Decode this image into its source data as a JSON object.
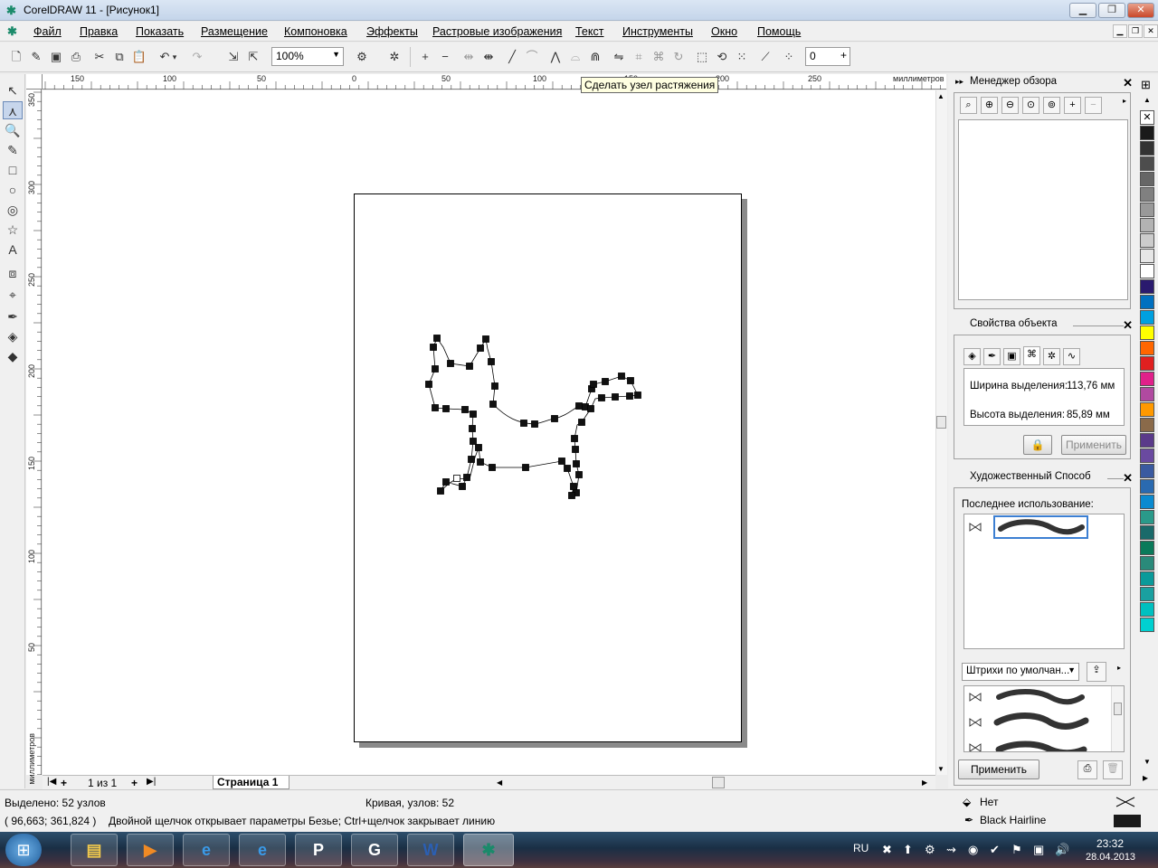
{
  "window": {
    "title": "CorelDRAW 11 - [Рисунок1]"
  },
  "menu": [
    "Файл",
    "Правка",
    "Показать",
    "Размещение",
    "Компоновка",
    "Эффекты",
    "Растровые изображения",
    "Текст",
    "Инструменты",
    "Окно",
    "Помощь"
  ],
  "toolbar": {
    "zoom": "100%",
    "nudge": "0"
  },
  "tooltip": "Сделать узел растяжения",
  "ruler": {
    "units": "миллиметров",
    "h_ticks": [
      "150",
      "100",
      "50",
      "0",
      "50",
      "100",
      "150",
      "200",
      "250"
    ],
    "v_ticks": [
      "350",
      "300",
      "250",
      "200",
      "150",
      "100",
      "50"
    ]
  },
  "pages": {
    "count": "1 из 1",
    "current_tab": "Страница 1"
  },
  "docker": {
    "overview": {
      "title": "Менеджер обзора"
    },
    "object_props": {
      "title": "Свойства объекта",
      "width_label": "Ширина выделения:",
      "width_value": "113,76 мм",
      "height_label": "Высота выделения:",
      "height_value": "85,89 мм",
      "apply": "Применить"
    },
    "artistic": {
      "title": "Художественный Способ",
      "recent": "Последнее использование:",
      "preset": "Штрихи по умолчан...",
      "apply": "Применить"
    }
  },
  "status": {
    "selected": "Выделено: 52 узлов",
    "curve": "Кривая, узлов: 52",
    "coords": "( 96,663; 361,824 )",
    "hint": "Двойной щелчок открывает параметры Безье; Ctrl+щелчок закрывает линию",
    "fill": "Нет",
    "outline": "Black  Hairline"
  },
  "taskbar": {
    "lang": "RU",
    "time": "23:32",
    "date": "28.04.2013"
  },
  "palette": [
    "#ffffff",
    "#1a1a1a",
    "#333333",
    "#4d4d4d",
    "#666666",
    "#808080",
    "#999999",
    "#b3b3b3",
    "#cccccc",
    "#e6e6e6",
    "#ffffff",
    "#2a1a6e",
    "#0070c0",
    "#00a0e0",
    "#ffff00",
    "#ff6600",
    "#e02020",
    "#e0208a",
    "#b04aa0",
    "#ff9900",
    "#8a6a4a",
    "#5a3a8a",
    "#6a4aa0",
    "#3a5aa0",
    "#2a6ab0",
    "#0a8ad0",
    "#2a9a8a",
    "#1a6a6a",
    "#0a7a5a",
    "#2a8a7a",
    "#0a9a9a",
    "#1aa0a0",
    "#00c0c0",
    "#00d0d0"
  ]
}
